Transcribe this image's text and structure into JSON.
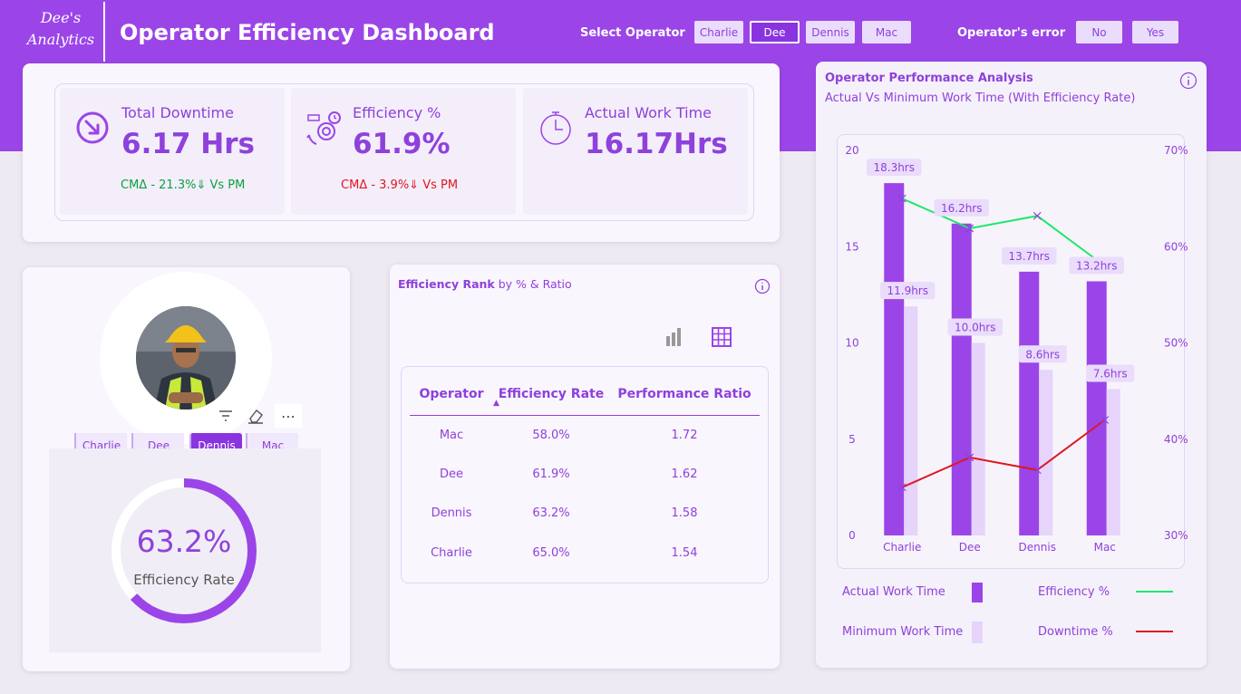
{
  "header": {
    "logo_line1": "Dee's",
    "logo_line2": "Analytics",
    "title": "Operator Efficiency Dashboard",
    "select_operator_label": "Select Operator",
    "operators": [
      "Charlie",
      "Dee",
      "Dennis",
      "Mac"
    ],
    "selected_operator": "Dee",
    "error_label": "Operator's error",
    "error_options": [
      "No",
      "Yes"
    ]
  },
  "kpis": [
    {
      "label": "Total Downtime",
      "value": "6.17 Hrs",
      "note": "CMΔ - 21.3%⇓ Vs PM",
      "icon": "downtime-arrow-icon"
    },
    {
      "label": "Efficiency %",
      "value": "61.9%",
      "note": "CMΔ - 3.9%⇓  Vs PM",
      "icon": "gears-icon"
    },
    {
      "label": "Actual Work Time",
      "value": "16.17Hrs",
      "note": "",
      "icon": "clock-icon"
    }
  ],
  "colors": {
    "accent": "#9b45e8",
    "accent_dark": "#8a34e0",
    "light_bar": "#e6d4fb",
    "green": "#0aa13f",
    "red": "#e0161f",
    "line_green": "#1ee86a",
    "line_red": "#e0161f"
  },
  "operator_panel": {
    "buttons": [
      "Charlie",
      "Dee",
      "Dennis",
      "Mac"
    ],
    "selected": "Dennis",
    "gauge_value": "63.2%",
    "gauge_fraction": 0.632,
    "gauge_label": "Efficiency Rate"
  },
  "rank": {
    "title_bold": "Efficiency Rank",
    "title_rest": " by % & Ratio",
    "columns": [
      "Operator",
      "Efficiency Rate",
      "Performance Ratio"
    ],
    "rows": [
      [
        "Mac",
        "58.0%",
        "1.72"
      ],
      [
        "Dee",
        "61.9%",
        "1.62"
      ],
      [
        "Dennis",
        "63.2%",
        "1.58"
      ],
      [
        "Charlie",
        "65.0%",
        "1.54"
      ]
    ]
  },
  "perf": {
    "title": "Operator Performance Analysis",
    "subtitle": "Actual Vs Minimum Work Time (With Efficiency Rate)",
    "legend": [
      "Actual Work Time",
      "Efficiency %",
      "Minimum Work Time",
      "Downtime %"
    ]
  },
  "chart_data": {
    "type": "bar",
    "categories": [
      "Charlie",
      "Dee",
      "Dennis",
      "Mac"
    ],
    "series": [
      {
        "name": "Actual Work Time",
        "values": [
          18.3,
          16.2,
          13.7,
          13.2
        ],
        "labels": [
          "18.3hrs",
          "16.2hrs",
          "13.7hrs",
          "13.2hrs"
        ],
        "axis": "left"
      },
      {
        "name": "Minimum Work Time",
        "values": [
          11.9,
          10.0,
          8.6,
          7.6
        ],
        "labels": [
          "11.9hrs",
          "10.0hrs",
          "8.6hrs",
          "7.6hrs"
        ],
        "axis": "left"
      },
      {
        "name": "Efficiency %",
        "type": "line",
        "values": [
          65.0,
          61.9,
          63.2,
          58.0
        ],
        "axis": "right"
      },
      {
        "name": "Downtime %",
        "type": "line",
        "values": [
          35.0,
          38.1,
          36.8,
          42.0
        ],
        "axis": "right"
      }
    ],
    "ylim": [
      0,
      20
    ],
    "yticks": [
      "0",
      "5",
      "10",
      "15",
      "20"
    ],
    "y2lim": [
      30,
      70
    ],
    "y2ticks": [
      "30%",
      "40%",
      "50%",
      "60%",
      "70%"
    ],
    "legend": "bottom"
  }
}
